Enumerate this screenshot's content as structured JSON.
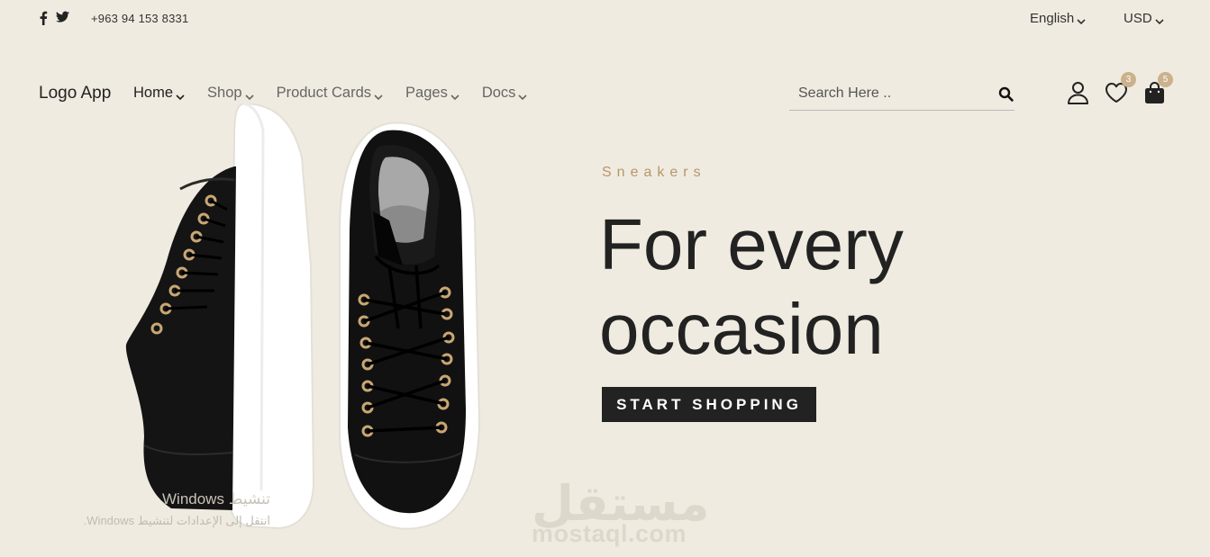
{
  "topbar": {
    "social": [
      {
        "icon": "facebook-icon"
      },
      {
        "icon": "twitter-icon"
      }
    ],
    "phone": "+963 94 153 8331",
    "language": "English",
    "currency": "USD"
  },
  "header": {
    "logo": "Logo App",
    "nav": [
      {
        "label": "Home",
        "active": true
      },
      {
        "label": "Shop"
      },
      {
        "label": "Product Cards"
      },
      {
        "label": "Pages"
      },
      {
        "label": "Docs"
      }
    ],
    "search": {
      "placeholder": "Search Here .."
    },
    "wishlist_count": "3",
    "cart_count": "5"
  },
  "hero": {
    "eyebrow": "Sneakers",
    "headline_line1": "For every",
    "headline_line2": "occasion",
    "cta": "START SHOPPING"
  },
  "watermark": {
    "arabic": "مستقل",
    "latin": "mostaql.com"
  },
  "windows_notice": {
    "title": "تنشيط Windows",
    "subtitle": "انتقل إلى الإعدادات لتنشيط Windows."
  },
  "colors": {
    "background": "#f0ebe0",
    "accent": "#c9b28c",
    "dark": "#222222"
  }
}
